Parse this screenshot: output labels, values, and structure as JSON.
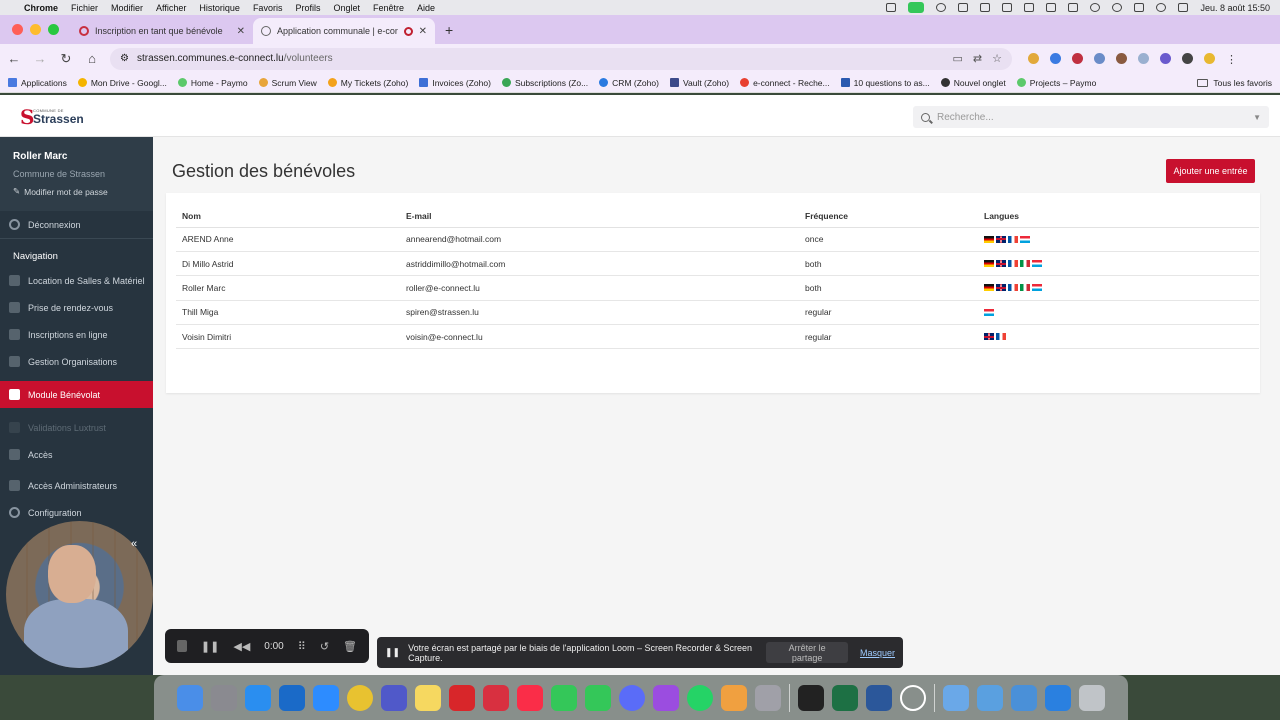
{
  "menubar": {
    "items": [
      "Chrome",
      "Fichier",
      "Modifier",
      "Afficher",
      "Historique",
      "Favoris",
      "Profils",
      "Onglet",
      "Fenêtre",
      "Aide"
    ],
    "clock": "Jeu. 8 août  15:50"
  },
  "tabs": [
    {
      "title": "Inscription en tant que bénévole",
      "active": false
    },
    {
      "title": "Application communale | e-connect",
      "active": true
    }
  ],
  "omnibox": {
    "host": "strassen.communes.e-connect.lu",
    "path": "/volunteers"
  },
  "bookmarks": {
    "items": [
      "Applications",
      "Mon Drive - Googl...",
      "Home - Paymo",
      "Scrum View",
      "My Tickets (Zoho)",
      "Invoices (Zoho)",
      "Subscriptions (Zo...",
      "CRM (Zoho)",
      "Vault (Zoho)",
      "e-connect - Reche...",
      "10 questions to as...",
      "Nouvel onglet",
      "Projects – Paymo"
    ],
    "all": "Tous les favoris"
  },
  "logo": {
    "small": "COMMUNE DE",
    "big": "Strassen"
  },
  "search": {
    "placeholder": "Recherche..."
  },
  "sidebar": {
    "user_name": "Roller Marc",
    "commune": "Commune de Strassen",
    "change_password": "Modifier mot de passe",
    "logout": "Déconnexion",
    "nav_heading": "Navigation",
    "items": [
      {
        "label": "Location de Salles & Matériel",
        "active": false,
        "disabled": false
      },
      {
        "label": "Prise de rendez-vous",
        "active": false,
        "disabled": false
      },
      {
        "label": "Inscriptions en ligne",
        "active": false,
        "disabled": false
      },
      {
        "label": "Gestion Organisations",
        "active": false,
        "disabled": false
      },
      {
        "label": "Module Bénévolat",
        "active": true,
        "disabled": false
      },
      {
        "label": "Validations Luxtrust",
        "active": false,
        "disabled": true
      },
      {
        "label": "Accès",
        "active": false,
        "disabled": false
      },
      {
        "label": "Accès Administrateurs",
        "active": false,
        "disabled": false
      },
      {
        "label": "Configuration",
        "active": false,
        "disabled": false
      }
    ]
  },
  "main": {
    "title": "Gestion des bénévoles",
    "add_button": "Ajouter une entrée",
    "columns": [
      "Nom",
      "E-mail",
      "Fréquence",
      "Langues"
    ],
    "rows": [
      {
        "name": "AREND Anne",
        "email": "annearend@hotmail.com",
        "frequency": "once",
        "languages": [
          "de",
          "gb",
          "fr",
          "lu"
        ]
      },
      {
        "name": "Di Millo Astrid",
        "email": "astriddimillo@hotmail.com",
        "frequency": "both",
        "languages": [
          "de",
          "gb",
          "fr",
          "it",
          "lu"
        ]
      },
      {
        "name": "Roller Marc",
        "email": "roller@e-connect.lu",
        "frequency": "both",
        "languages": [
          "de",
          "gb",
          "fr",
          "it",
          "lu"
        ]
      },
      {
        "name": "Thill Miga",
        "email": "spiren@strassen.lu",
        "frequency": "regular",
        "languages": [
          "lu"
        ]
      },
      {
        "name": "Voisin Dimitri",
        "email": "voisin@e-connect.lu",
        "frequency": "regular",
        "languages": [
          "gb",
          "fr"
        ]
      }
    ]
  },
  "loom": {
    "timer": "0:00",
    "share_text": "Votre écran est partagé par le biais de l'application Loom – Screen Recorder & Screen Capture.",
    "stop_share": "Arrêter le partage",
    "hide": "Masquer"
  },
  "colors": {
    "accent": "#c8102e",
    "sidebar": "#27343f"
  }
}
